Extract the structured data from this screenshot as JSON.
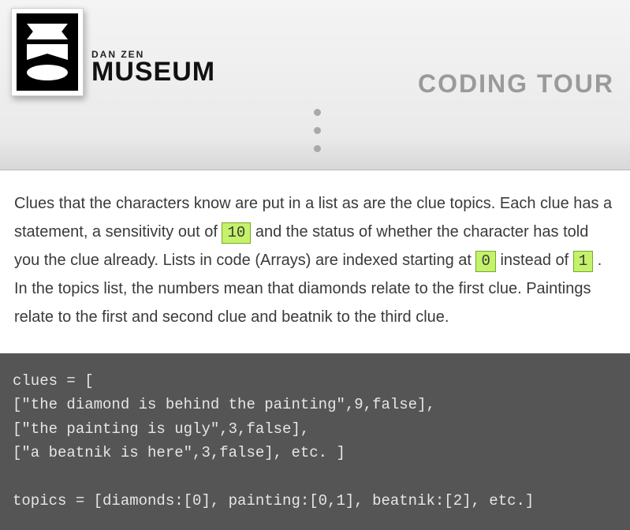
{
  "header": {
    "subhead": "DAN ZEN",
    "mainhead": "MUSEUM",
    "tour_label": "CODING TOUR"
  },
  "body": {
    "t1": "Clues that the characters know are put in a list as are the clue topics. Each clue has a statement, a sensitivity out of ",
    "hl1": "10",
    "t2": " and the status of whether the character has told you the clue already. Lists in code (Arrays) are indexed starting at ",
    "hl2": "0",
    "t3": " instead of ",
    "hl3": "1",
    "t4": ". In the topics list, the numbers mean that diamonds relate to the first clue. Paintings relate to the first and second clue and beatnik to the third clue."
  },
  "code": "clues = [\n[\"the diamond is behind the painting\",9,false],\n[\"the painting is ugly\",3,false],\n[\"a beatnik is here\",3,false], etc. ]\n\ntopics = [diamonds:[0], painting:[0,1], beatnik:[2], etc.]"
}
